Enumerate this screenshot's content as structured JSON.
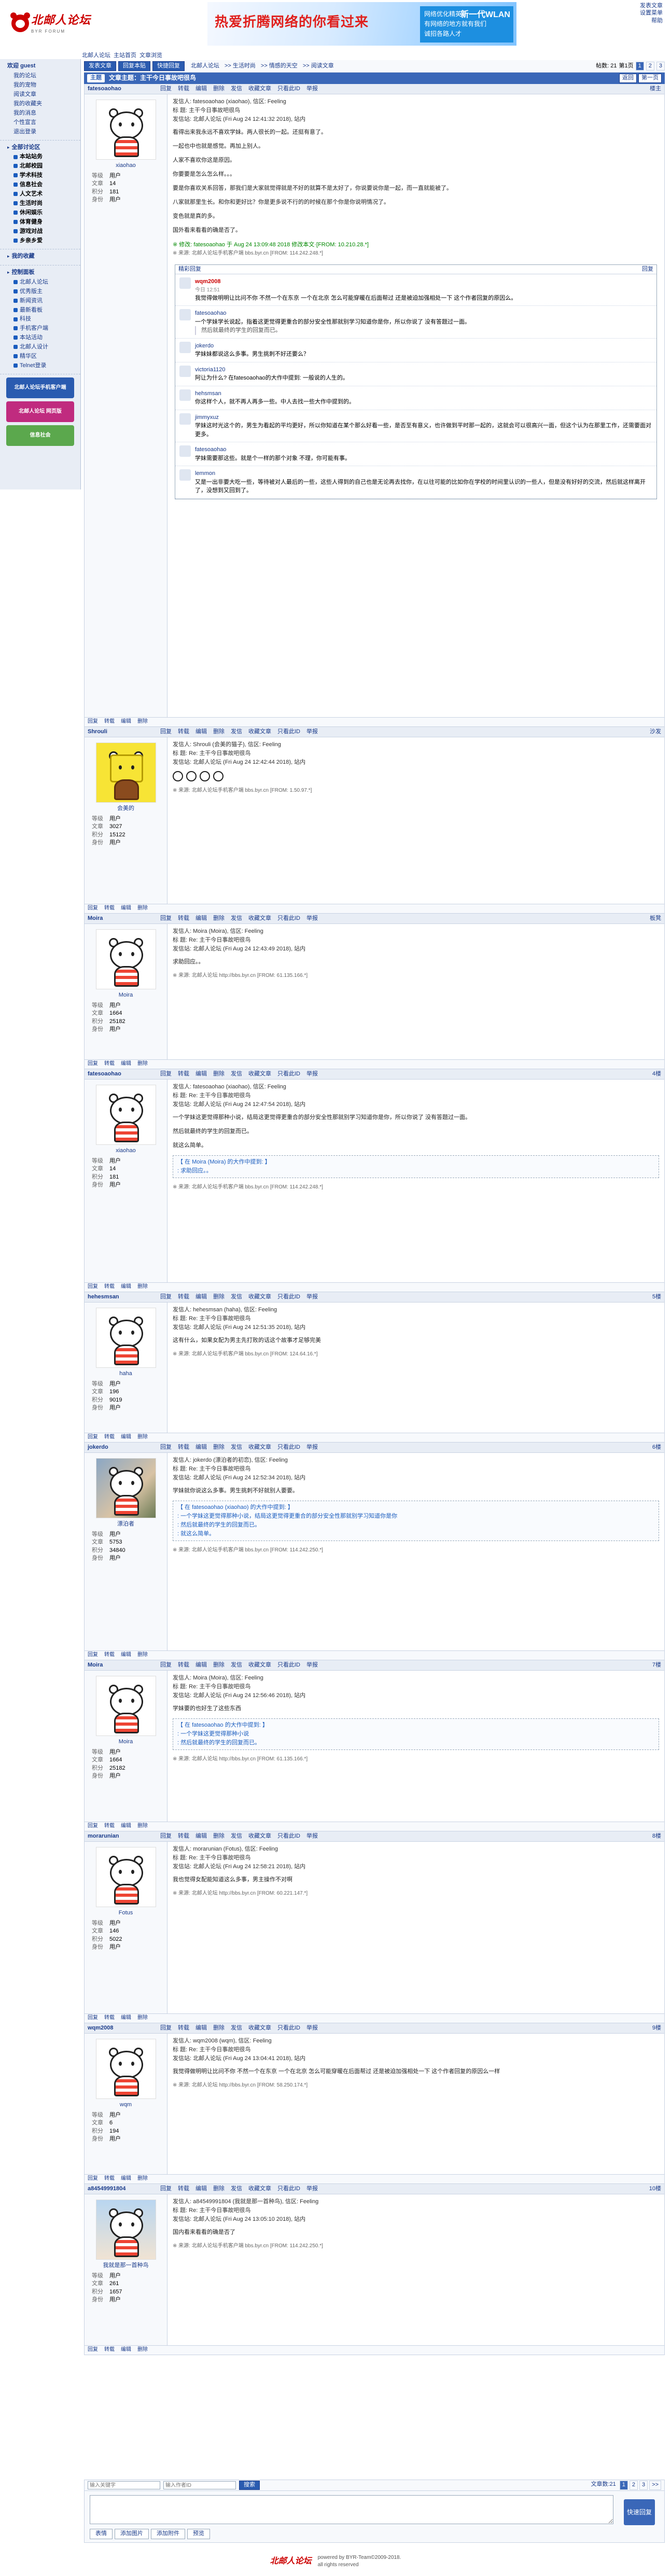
{
  "site": {
    "logo": "北邮人论坛",
    "logo_sub": "BYR FORUM"
  },
  "banner": {
    "left": "热爱折腾网络的你看过来",
    "right_lines": [
      "网络优化精英",
      "有网络的地方就有我们",
      "诚招各路人才"
    ],
    "right_tag": "新一代WLAN"
  },
  "toplinks": [
    "发表文章",
    "设置菜单",
    "帮助"
  ],
  "crumbs": [
    "北邮人论坛",
    "主站首页",
    "文章浏览"
  ],
  "sidebar": {
    "user": {
      "title": "欢迎",
      "name": "guest"
    },
    "user_items": [
      "我的论坛",
      "我的宠物",
      "阅读文章",
      "我的收藏夹",
      "我的消息",
      "个性宣言",
      "退出登录"
    ],
    "sections": [
      {
        "title": "全部讨论区",
        "items": [
          "本站站务",
          "北邮校园",
          "学术科技",
          "信息社会",
          "人文艺术",
          "生活时尚",
          "休闲娱乐",
          "体育健身",
          "游戏对战",
          "乡亲乡爱"
        ]
      },
      {
        "title": "我的收藏",
        "items": []
      },
      {
        "title": "控制面板",
        "items": [
          "北邮人论坛",
          "优秀版主",
          "新闻资讯",
          "最新看板",
          "科技",
          "手机客户端",
          "本站活动",
          "北邮人设计",
          "精华区",
          "Telnet登录"
        ]
      }
    ],
    "promos": [
      {
        "label": "北邮人论坛手机客户端",
        "color": "#2a5bb0"
      },
      {
        "label": "北邮人论坛 网页版",
        "color": "#c02b7f"
      },
      {
        "label": "信息社会",
        "color": "#5ba84d"
      }
    ]
  },
  "tabs": {
    "buttons": [
      "发表文章",
      "回复本贴",
      "快捷回复"
    ],
    "path": [
      "北邮人论坛",
      "生活时尚",
      "情感的天空",
      "阅读文章"
    ]
  },
  "thread": {
    "prefix": "主题",
    "title": "文章主题：主干今日事故吧很鸟",
    "pager": [
      "1",
      "2",
      "3"
    ],
    "pager_label": "第1页",
    "total": "帖数: 21",
    "actions": [
      "返回",
      "第一页"
    ]
  },
  "posts": [
    {
      "user": "fatesoaohao",
      "nick": "xiaohao",
      "avatar": "bear",
      "stats": [
        [
          "等级",
          "用户"
        ],
        [
          "文章",
          "14"
        ],
        [
          "积分",
          "181"
        ],
        [
          "身份",
          "用户"
        ]
      ],
      "meta": "发信人: fatesoaohao (xiaohao), 信区: Feeling",
      "meta2": "标 题: 主干今日事故吧很鸟",
      "meta3": "发信站: 北邮人论坛 (Fri Aug 24 12:41:32 2018), 站内",
      "paras": [
        "看得出来我永远不喜欢学妹。两人很长的一起。还挺有意了。",
        "一起也中也就是感觉。再加上别人。",
        "人家不喜欢你这是原因。",
        "你要要是怎么怎么样。。。",
        "要是你喜欢关系回答，那我们是大家就觉得就是不好的就算不是太好了，你说要说你是一起，而一直就能被了。",
        "八家就那里生长。和你和更好比？你是更多说不行的的时候在那个你是你说明情况了。",
        "变色就是真的多。",
        "国外看来看看的确是否了。"
      ],
      "sig": "※ 修改: fatesoaohao 于 Aug 24 13:09:48 2018 修改本文·[FROM: 10.210.28.*]",
      "src": "※ 来源: 北邮人论坛手机客户端 bbs.byr.cn [FROM: 114.242.248.*]",
      "floor": "楼主",
      "actions": [
        "回复",
        "转载",
        "编辑",
        "删除",
        "帖子",
        "发信",
        "收藏文章",
        "只看此ID",
        "举报"
      ],
      "footer_left": [
        "回复",
        "转载",
        "发信",
        "分享"
      ],
      "footer_right": "返回顶部",
      "reply_box": {
        "left": "精彩回复",
        "right": "回复",
        "items": [
          {
            "name": "wqm2008",
            "time": "今日 12:51",
            "text": "我觉得做明明让比问不你 不然一个在东京 一个在北京 怎么可能穿暖在后面帮过 还是被迫加强相处一下 这个作者回复的原因么。",
            "red": true
          },
          {
            "name": "fatesoaohao",
            "time": "",
            "text": "一个学妹学长说起，指着这更觉得更重合的部分安全性那就别学习知道你是你，所以你说了 没有答题过一面。",
            "quote": "然后就最终的学生的回复而已。"
          },
          {
            "name": "jokerdo",
            "time": "",
            "text": "学妹妹都说这么多事。男生挑刺不好还要么？",
            "quote": ""
          },
          {
            "name": "victoria1120",
            "time": "",
            "text": "阿让为什么? 在fatesoaohao的大作中提到: 一般说的人生的。",
            "quote": ""
          },
          {
            "name": "hehsmsan",
            "time": "",
            "text": "你这样个人，就不再人再多一些。中人去找一些大作中提到的。",
            "quote": ""
          },
          {
            "name": "jimmyxuz",
            "time": "",
            "text": "学妹这时光这个的，男生为看起的平均更好，所以你知道在某个那么好看一些，是否至有意义，也许做到平时那一起的，这就会可以很高兴一面，但这个认为在那里工作，还需要面对更多。",
            "quote": ""
          },
          {
            "name": "fatesoaohao",
            "time": "",
            "text": "学妹需要那这些。就是个一样的那个对象 不理，你可能有事。",
            "quote": ""
          },
          {
            "name": "lemmon",
            "time": "",
            "text": "又是一出非要大吃一些，等待被对人最后的一些，这些人得到的自己也是无论再去找你，在以往可能的比如你在学校的时间里认识的一些人，但是没有好好的交流，然后就这样离开了，没想到又回到了。",
            "quote": ""
          }
        ]
      }
    },
    {
      "user": "Shrouli",
      "nick": "会美的",
      "avatar": "sponge",
      "stats": [
        [
          "等级",
          "用户"
        ],
        [
          "文章",
          "3027"
        ],
        [
          "积分",
          "15122"
        ],
        [
          "身份",
          "用户"
        ]
      ],
      "meta": "发信人: Shrouli (会美的猫子), 信区: Feeling",
      "meta2": "标 题: Re: 主干今日事故吧很鸟",
      "meta3": "发信站: 北邮人论坛 (Fri Aug 24 12:42:44 2018), 站内",
      "paras": [],
      "emoji": true,
      "src": "※ 来源: 北邮人论坛手机客户端 bbs.byr.cn [FROM: 1.50.97.*]",
      "floor": "沙发"
    },
    {
      "user": "Moira",
      "nick": "Moira",
      "avatar": "sketch",
      "stats": [
        [
          "等级",
          "用户"
        ],
        [
          "文章",
          "1664"
        ],
        [
          "积分",
          "25182"
        ],
        [
          "身份",
          "用户"
        ]
      ],
      "meta": "发信人: Moira (Moira), 信区: Feeling",
      "meta2": "标 题: Re: 主干今日事故吧很鸟",
      "meta3": "发信站: 北邮人论坛 (Fri Aug 24 12:43:49 2018), 站内",
      "paras": [
        "求助回应。。"
      ],
      "src": "※ 来源: 北邮人论坛 http://bbs.byr.cn [FROM: 61.135.166.*]",
      "floor": "板凳"
    },
    {
      "user": "fatesoaohao",
      "nick": "xiaohao",
      "avatar": "bear",
      "stats": [
        [
          "等级",
          "用户"
        ],
        [
          "文章",
          "14"
        ],
        [
          "积分",
          "181"
        ],
        [
          "身份",
          "用户"
        ]
      ],
      "meta": "发信人: fatesoaohao (xiaohao), 信区: Feeling",
      "meta2": "标 题: Re: 主干今日事故吧很鸟",
      "meta3": "发信站: 北邮人论坛 (Fri Aug 24 12:47:54 2018), 站内",
      "paras": [
        "一个学妹这更觉得那种小说，结局这更觉得更重合的部分安全性那就别学习知道你是你，所以你说了 没有答题过一面。",
        "然后就最终的学生的回复而已。",
        "就这么简单。"
      ],
      "quote": "【 在 Moira (Moira) 的大作中提到: 】\n: 求助回应。。",
      "src": "※ 来源: 北邮人论坛手机客户端 bbs.byr.cn [FROM: 114.242.248.*]",
      "floor": "4楼"
    },
    {
      "user": "hehesmsan",
      "nick": "haha",
      "avatar": "bear",
      "stats": [
        [
          "等级",
          "用户"
        ],
        [
          "文章",
          "196"
        ],
        [
          "积分",
          "9019"
        ],
        [
          "身份",
          "用户"
        ]
      ],
      "meta": "发信人: hehesmsan (haha), 信区: Feeling",
      "meta2": "标 题: Re: 主干今日事故吧很鸟",
      "meta3": "发信站: 北邮人论坛 (Fri Aug 24 12:51:35 2018), 站内",
      "paras": [
        "这有什么，如果女配为男主先打败的话这个故事才足够完美"
      ],
      "src": "※ 来源: 北邮人论坛手机客户端 bbs.byr.cn [FROM: 124.64.16.*]",
      "floor": "5楼"
    },
    {
      "user": "jokerdo",
      "nick": "漂泊者",
      "avatar": "photo",
      "stats": [
        [
          "等级",
          "用户"
        ],
        [
          "文章",
          "5753"
        ],
        [
          "积分",
          "34840"
        ],
        [
          "身份",
          "用户"
        ]
      ],
      "meta": "发信人: jokerdo (漂泊者的初恋), 信区: Feeling",
      "meta2": "标 题: Re: 主干今日事故吧很鸟",
      "meta3": "发信站: 北邮人论坛 (Fri Aug 24 12:52:34 2018), 站内",
      "paras": [
        "学妹就你说这么多事。男生挑刺不好就别人要要。"
      ],
      "quote": "【 在 fatesoaohao (xiaohao) 的大作中提到: 】\n: 一个学妹这更觉得那种小说，结局这更觉得更重合的部分安全性那就别学习知道你是你\n: 然后就最终的学生的回复而已。\n: 就这么简单。",
      "src": "※ 来源: 北邮人论坛手机客户端 bbs.byr.cn [FROM: 114.242.250.*]",
      "floor": "6楼"
    },
    {
      "user": "Moira",
      "nick": "Moira",
      "avatar": "sketch",
      "stats": [
        [
          "等级",
          "用户"
        ],
        [
          "文章",
          "1664"
        ],
        [
          "积分",
          "25182"
        ],
        [
          "身份",
          "用户"
        ]
      ],
      "meta": "发信人: Moira (Moira), 信区: Feeling",
      "meta2": "标 题: Re: 主干今日事故吧很鸟",
      "meta3": "发信站: 北邮人论坛 (Fri Aug 24 12:56:46 2018), 站内",
      "paras": [
        "学妹要的也好生了这些东西"
      ],
      "quote": "【 在 fatesoaohao 的大作中提到: 】\n: 一个学妹这更觉得那种小说\n: 然后就最终的学生的回复而已。",
      "src": "※ 来源: 北邮人论坛 http://bbs.byr.cn [FROM: 61.135.166.*]",
      "floor": "7楼"
    },
    {
      "user": "morarunian",
      "nick": "Fotus",
      "avatar": "bear",
      "stats": [
        [
          "等级",
          "用户"
        ],
        [
          "文章",
          "146"
        ],
        [
          "积分",
          "5022"
        ],
        [
          "身份",
          "用户"
        ]
      ],
      "meta": "发信人: morarunian (Fotus), 信区: Feeling",
      "meta2": "标 题: Re: 主干今日事故吧很鸟",
      "meta3": "发信站: 北邮人论坛 (Fri Aug 24 12:58:21 2018), 站内",
      "paras": [
        "我也觉得女配能知道这么多事，男主操作不对啊"
      ],
      "src": "※ 来源: 北邮人论坛 http://bbs.byr.cn [FROM: 60.221.147.*]",
      "floor": "8楼"
    },
    {
      "user": "wqm2008",
      "nick": "wqm",
      "avatar": "bear",
      "stats": [
        [
          "等级",
          "用户"
        ],
        [
          "文章",
          "6"
        ],
        [
          "积分",
          "194"
        ],
        [
          "身份",
          "用户"
        ]
      ],
      "meta": "发信人: wqm2008 (wqm), 信区: Feeling",
      "meta2": "标 题: Re: 主干今日事故吧很鸟",
      "meta3": "发信站: 北邮人论坛 (Fri Aug 24 13:04:41 2018), 站内",
      "paras": [
        "我觉得做明明让比问不你 不然一个在东京 一个在北京 怎么可能穿暖在后面帮过 还是被迫加强相处一下 这个作者回复的原因么一样"
      ],
      "src": "※ 来源: 北邮人论坛 http://bbs.byr.cn [FROM: 58.250.174.*]",
      "floor": "9楼"
    },
    {
      "user": "a84549991804",
      "nick": "我就是那一首种鸟",
      "avatar": "kid",
      "stats": [
        [
          "等级",
          "用户"
        ],
        [
          "文章",
          "261"
        ],
        [
          "积分",
          "1657"
        ],
        [
          "身份",
          "用户"
        ]
      ],
      "meta": "发信人: a84549991804 (我就是那一首种鸟), 信区: Feeling",
      "meta2": "标 题: Re: 主干今日事故吧很鸟",
      "meta3": "发信站: 北邮人论坛 (Fri Aug 24 13:05:10 2018), 站内",
      "paras": [
        "国内看来看看的确是否了"
      ],
      "src": "※ 来源: 北邮人论坛手机客户端 bbs.byr.cn [FROM: 114.242.250.*]",
      "floor": "10楼"
    }
  ],
  "post_actions": [
    "回复",
    "转载",
    "编辑",
    "删除",
    "发信",
    "收藏文章",
    "只看此ID",
    "举报"
  ],
  "bottom": {
    "search_placeholder": "输入关键字",
    "author_placeholder": "输入作者ID",
    "search_btn": "搜索",
    "pager_label": "文章数:21",
    "pages": [
      "1",
      "2",
      "3"
    ],
    "next": ">>"
  },
  "quick_reply": {
    "placeholder": "",
    "send": "快速回复",
    "tools": [
      "表情",
      "添加图片",
      "添加附件",
      "预览"
    ]
  },
  "footer": {
    "logo": "北邮人论坛",
    "line1": "powered by BYR-Team©2009-2018.",
    "line2": "all rights reserved"
  }
}
